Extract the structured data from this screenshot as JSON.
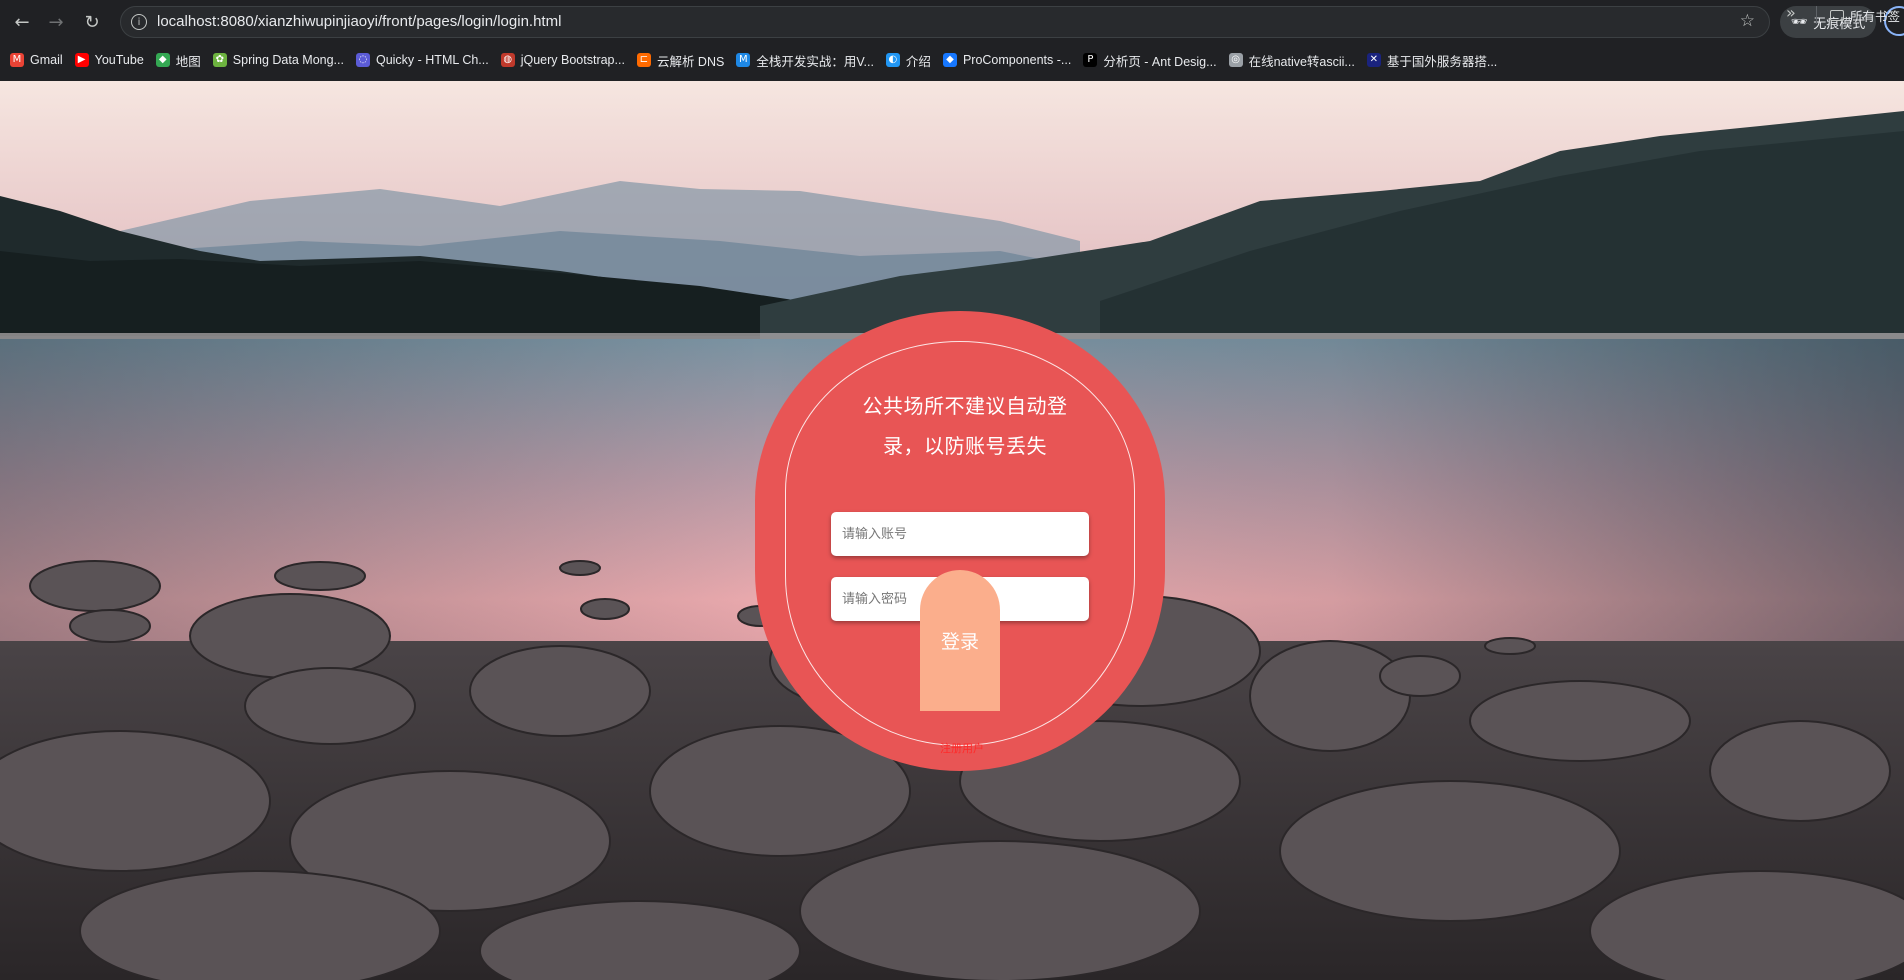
{
  "browser": {
    "url": "localhost:8080/xianzhiwupinjiaoyi/front/pages/login/login.html",
    "incognito_label": "无痕模式",
    "bookmarks": [
      {
        "label": "Gmail",
        "icon": "gmail-icon",
        "color": "#ea4335"
      },
      {
        "label": "YouTube",
        "icon": "youtube-icon",
        "color": "#ff0000"
      },
      {
        "label": "地图",
        "icon": "maps-icon",
        "color": "#34a853"
      },
      {
        "label": "Spring Data Mong...",
        "icon": "spring-icon",
        "color": "#6db33f"
      },
      {
        "label": "Quicky - HTML Ch...",
        "icon": "quicky-icon",
        "color": "#5b5bd6"
      },
      {
        "label": "jQuery Bootstrap...",
        "icon": "jquery-icon",
        "color": "#c0392b"
      },
      {
        "label": "云解析 DNS",
        "icon": "aliyun-icon",
        "color": "#ff6a00"
      },
      {
        "label": "全栈开发实战：用V...",
        "icon": "m-icon",
        "color": "#1e88e5"
      },
      {
        "label": "介绍",
        "icon": "globe-blue-icon",
        "color": "#2196f3"
      },
      {
        "label": "ProComponents -...",
        "icon": "antd-icon",
        "color": "#1677ff"
      },
      {
        "label": "分析页 - Ant Desig...",
        "icon": "pro-icon",
        "color": "#000000"
      },
      {
        "label": "在线native转ascii...",
        "icon": "globe-icon",
        "color": "#9aa0a6"
      },
      {
        "label": "基于国外服务器搭...",
        "icon": "flag-icon",
        "color": "#1a237e"
      }
    ],
    "all_bookmarks_label": "所有书签"
  },
  "login": {
    "tip_line1": "公共场所不建议自动登",
    "tip_line2": "录，以防账号丢失",
    "account_placeholder": "请输入账号",
    "password_placeholder": "请输入密码",
    "login_button": "登录",
    "register_link": "注册用户"
  },
  "colors": {
    "card": "#e85555",
    "login_button": "#fbae8c",
    "register_link": "#ff2a2a"
  }
}
